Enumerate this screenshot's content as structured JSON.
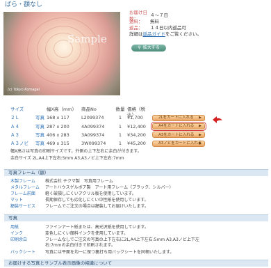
{
  "title": "ばら・額なし",
  "photo": {
    "watermark": "Sample",
    "credit": "(c) Tokyo Komagai"
  },
  "info": {
    "delivery_label": "お届け日数：",
    "delivery_value": "４〜７日",
    "shipping_label": "送料：",
    "shipping_value": "無料",
    "return_label": "返品：",
    "return_value": "１４日以内返品可",
    "detail_prefix": "詳細は",
    "detail_link": "返品ガイド",
    "detail_suffix": "をご覧ください。",
    "zoom_button": "拡大する"
  },
  "table": {
    "headers": [
      "サイズ",
      "",
      "幅X高（mm）",
      "商品No",
      "数量",
      "価格（税込）"
    ],
    "rows": [
      {
        "size": "２Ｌ",
        "type": "写真",
        "dims": "168 x 117",
        "no": "L2099374",
        "qty": "1",
        "price": "¥1,700",
        "cart": "2Lをカートに入れる"
      },
      {
        "size": "Ａ４",
        "type": "写真",
        "dims": "287 x 200",
        "no": "4A099374",
        "qty": "1",
        "price": "¥12,400",
        "cart": "A4をカートに入れる"
      },
      {
        "size": "Ａ３",
        "type": "写真",
        "dims": "406 x 283",
        "no": "3A099374",
        "qty": "1",
        "price": "¥34,200",
        "cart": "A3をカートに入れる"
      },
      {
        "size": "Ａ３ノビ",
        "type": "写真",
        "dims": "469 x 315",
        "no": "3W099374",
        "qty": "1",
        "price": "¥45,200",
        "cart": "A3ノビをカートに入れる"
      }
    ],
    "note1": "幅X高さは写真の印刷サイズです。外側の上下左右に余白が付きます。",
    "note2": "余白サイズ 2L,A4上下左右:5mm A3,A3ノビ上下左右:7mm"
  },
  "frame": {
    "heading": "写真フレーム（額）",
    "rows": [
      {
        "k": "木製フレーム",
        "v": "株式会社 チクマ製　写真用フレーム"
      },
      {
        "k": "メタルフレーム",
        "v": "アートハウスゲルボア製　アート用フレーム（ブラック、シルバー）"
      },
      {
        "k": "フレーム前面",
        "v": "軽く破損しにくいアクリル板を使用しています。"
      },
      {
        "k": "マット",
        "v": "長期保存しても劣化しにくい中性紙を使用しています。"
      },
      {
        "k": "額装サービス",
        "v": "フレームでご注文の場合は額装してお届けいたします。"
      }
    ]
  },
  "photo_sec": {
    "heading": "写真",
    "rows": [
      {
        "k": "用紙",
        "v": "ファインアート紙または、高光沢紙を使用しています。"
      },
      {
        "k": "インク",
        "v": "変色しにくい顔料インクを使用しています。"
      },
      {
        "k": "印刷余白",
        "v1": "フレームなしでご注文の写真の上下左右に2L,A4上下左右:5mm A3,A3ノビ上下左",
        "v2": "右:7mmの余白付きで印刷されます。"
      },
      {
        "k": "バックシート",
        "v": "写真には平面を均一に保つ裏打ち用バックシートを同梱いたします。"
      }
    ]
  },
  "bottom_heading": "お届けする写真とサンプル表示画像の相違について"
}
